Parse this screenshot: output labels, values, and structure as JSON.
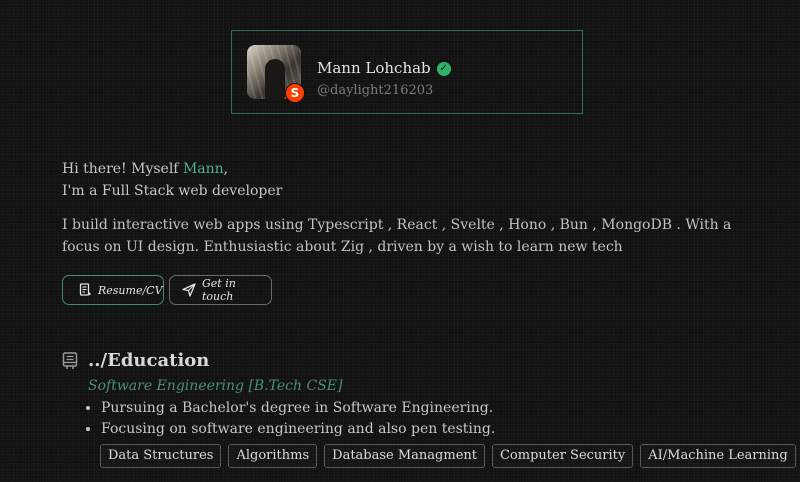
{
  "profile": {
    "name": "Mann Lohchab",
    "handle": "@daylight216203",
    "badge_letter": "S"
  },
  "intro": {
    "greeting_prefix": "Hi there! Myself ",
    "greeting_name": "Mann",
    "greeting_suffix": ",",
    "role": "I'm a Full Stack web developer",
    "description": "I build interactive web apps using Typescript , React , Svelte , Hono , Bun , MongoDB . With a focus on UI design. Enthusiastic about Zig , driven by a wish to learn new tech"
  },
  "buttons": {
    "resume_label": "Resume/CV",
    "contact_label": "Get in touch"
  },
  "education": {
    "title": "../Education",
    "degree": "Software Engineering [B.Tech CSE]",
    "bullets": [
      "Pursuing a Bachelor's degree in Software Engineering.",
      "Focusing on software engineering and also pen testing."
    ],
    "tags": [
      "Data Structures",
      "Algorithms",
      "Database Managment",
      "Computer Security",
      "AI/Machine Learning"
    ]
  },
  "colors": {
    "accent": "#4fb08a",
    "card_border": "#2f6e5a",
    "verified": "#2fb36b",
    "svelte": "#ff3e00",
    "background": "#111111"
  },
  "icons": {
    "verified": "verified-check-icon",
    "resume": "document-icon",
    "contact": "send-icon",
    "education": "book-icon"
  }
}
